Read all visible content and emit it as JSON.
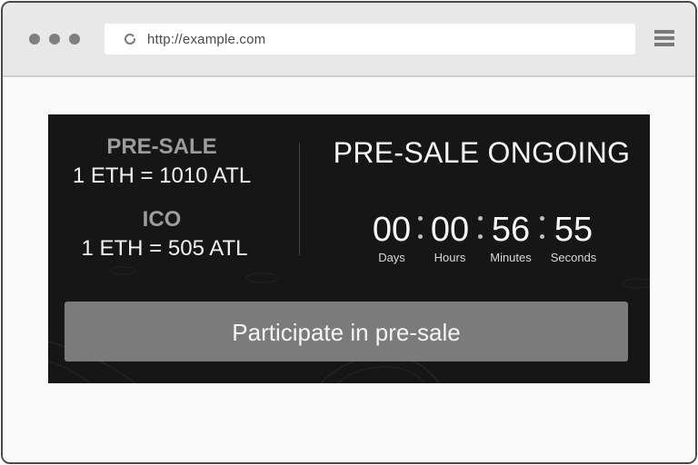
{
  "browser": {
    "url": "http://example.com",
    "icons": {
      "reload": "reload-icon",
      "menu": "hamburger-menu-icon"
    }
  },
  "rates": {
    "presale": {
      "title": "PRE-SALE",
      "value": "1 ETH = 1010 ATL"
    },
    "ico": {
      "title": "ICO",
      "value": "1 ETH = 505 ATL"
    }
  },
  "status": {
    "title": "PRE-SALE ONGOING",
    "countdown": [
      {
        "value": "00",
        "label": "Days"
      },
      {
        "value": "00",
        "label": "Hours"
      },
      {
        "value": "56",
        "label": "Minutes"
      },
      {
        "value": "55",
        "label": "Seconds"
      }
    ]
  },
  "cta": {
    "label": "Participate in pre-sale"
  },
  "colors": {
    "panel_bg": "#161616",
    "button_bg": "#7b7b7b",
    "muted_title": "#9c9c9c"
  }
}
